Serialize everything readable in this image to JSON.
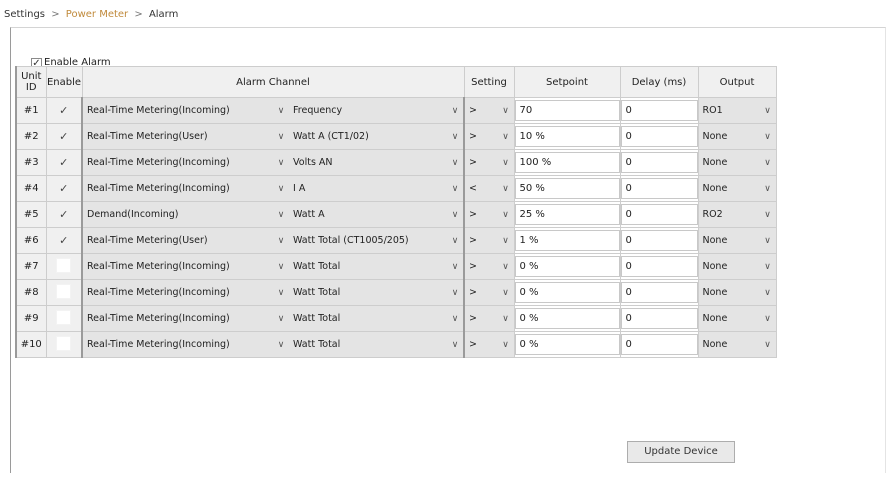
{
  "breadcrumb": {
    "items": [
      "Settings",
      "Power Meter",
      "Alarm"
    ],
    "separator": ">"
  },
  "enable_alarm": {
    "label": "Enable Alarm",
    "checked": true,
    "check_glyph": "✓"
  },
  "table": {
    "headers": {
      "unit_line1": "Unit",
      "unit_line2": "ID",
      "enable": "Enable",
      "alarm_channel": "Alarm Channel",
      "setting": "Setting",
      "setpoint": "Setpoint",
      "delay": "Delay (ms)",
      "output": "Output"
    },
    "rows": [
      {
        "unit": "#1",
        "enabled": true,
        "source": "Real-Time Metering(Incoming)",
        "target": "Frequency",
        "setting": ">",
        "setpoint": "70",
        "delay": "0",
        "output": "RO1"
      },
      {
        "unit": "#2",
        "enabled": true,
        "source": "Real-Time Metering(User)",
        "target": "Watt A (CT1/02)",
        "setting": ">",
        "setpoint": "10 %",
        "delay": "0",
        "output": "None"
      },
      {
        "unit": "#3",
        "enabled": true,
        "source": "Real-Time Metering(Incoming)",
        "target": "Volts AN",
        "setting": ">",
        "setpoint": "100 %",
        "delay": "0",
        "output": "None"
      },
      {
        "unit": "#4",
        "enabled": true,
        "source": "Real-Time Metering(Incoming)",
        "target": "I A",
        "setting": "<",
        "setpoint": "50 %",
        "delay": "0",
        "output": "None"
      },
      {
        "unit": "#5",
        "enabled": true,
        "source": "Demand(Incoming)",
        "target": "Watt A",
        "setting": ">",
        "setpoint": "25 %",
        "delay": "0",
        "output": "RO2"
      },
      {
        "unit": "#6",
        "enabled": true,
        "source": "Real-Time Metering(User)",
        "target": "Watt Total (CT1005/205)",
        "setting": ">",
        "setpoint": "1 %",
        "delay": "0",
        "output": "None"
      },
      {
        "unit": "#7",
        "enabled": false,
        "source": "Real-Time Metering(Incoming)",
        "target": "Watt Total",
        "setting": ">",
        "setpoint": "0 %",
        "delay": "0",
        "output": "None"
      },
      {
        "unit": "#8",
        "enabled": false,
        "source": "Real-Time Metering(Incoming)",
        "target": "Watt Total",
        "setting": ">",
        "setpoint": "0 %",
        "delay": "0",
        "output": "None"
      },
      {
        "unit": "#9",
        "enabled": false,
        "source": "Real-Time Metering(Incoming)",
        "target": "Watt Total",
        "setting": ">",
        "setpoint": "0 %",
        "delay": "0",
        "output": "None"
      },
      {
        "unit": "#10",
        "enabled": false,
        "source": "Real-Time Metering(Incoming)",
        "target": "Watt Total",
        "setting": ">",
        "setpoint": "0 %",
        "delay": "0",
        "output": "None"
      }
    ]
  },
  "dropdown_arrow": "∨",
  "check_glyph": "✓",
  "update_button": {
    "label": "Update Device"
  }
}
